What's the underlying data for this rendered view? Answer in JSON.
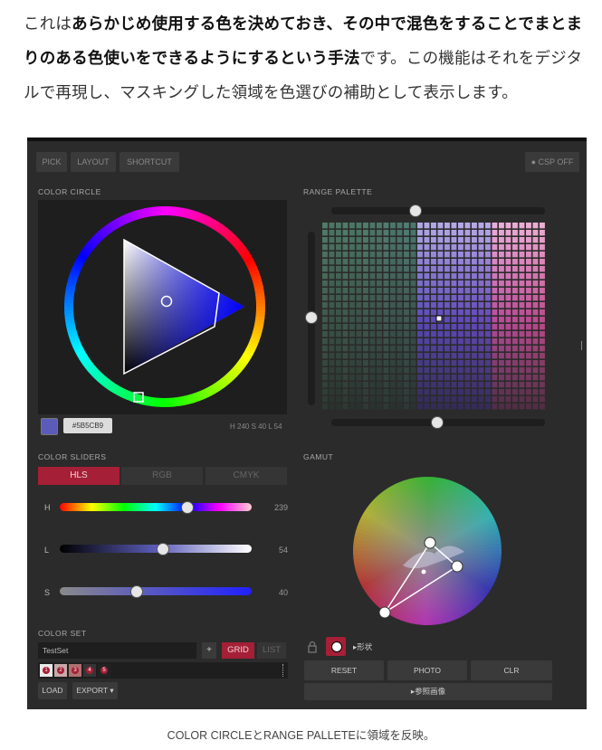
{
  "intro": {
    "p1": "これは",
    "p2": "あらかじめ使用する色を決めておき、その中で混色をすることでまとまりのある色使いをできるようにするという手法",
    "p3": "です。この機能はそれをデジタルで再現し、マスキングした領域を色選びの補助として表示します。"
  },
  "toolbar": {
    "pick": "PICK",
    "layout": "LAYOUT",
    "shortcut": "SHORTCUT",
    "csp": "CSP OFF"
  },
  "color_circle": {
    "title": "COLOR CIRCLE",
    "hex": "#5B5CB9",
    "h": "H 240",
    "s": "S 40",
    "l": "L 54",
    "swatch": "#5b5cb9"
  },
  "range_palette": {
    "title": "RANGE PALETTE"
  },
  "sliders": {
    "title": "COLOR SLIDERS",
    "tabs": [
      "HLS",
      "RGB",
      "CMYK"
    ],
    "h": {
      "label": "H",
      "value": "239",
      "level": 0.664
    },
    "l": {
      "label": "L",
      "value": "54",
      "level": 0.54
    },
    "s": {
      "label": "S",
      "value": "40",
      "level": 0.4
    }
  },
  "gamut": {
    "title": "GAMUT"
  },
  "color_set": {
    "title": "COLOR SET",
    "name": "TestSet",
    "add": "+",
    "grid": "GRID",
    "list": "LIST",
    "chips": [
      {
        "n": "1",
        "color": "#e8e8e8"
      },
      {
        "n": "2",
        "color": "#c9a9a9"
      },
      {
        "n": "3",
        "color": "#b07070"
      },
      {
        "n": "4",
        "color": "#353535"
      },
      {
        "n": "5",
        "color": "#222222"
      }
    ],
    "load": "LOAD",
    "export": "EXPORT ▾"
  },
  "gamut_tools": {
    "shape": "▸形状",
    "reset": "RESET",
    "photo": "PHOTO",
    "clr": "CLR",
    "ref": "▸参照画像"
  },
  "caption": "COLOR CIRCLEとRANGE PALLETEに領域を反映。",
  "colors": {
    "panel": "#2b2b2b",
    "accent": "#a51f36",
    "track_dark": "#1e1e1e"
  }
}
